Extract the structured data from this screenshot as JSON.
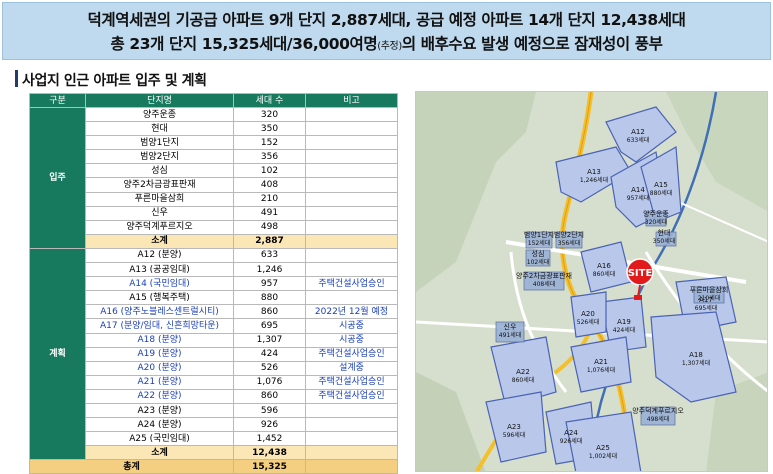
{
  "banner": {
    "line1": "덕계역세권의 기공급 아파트 9개 단지 2,887세대, 공급 예정 아파트 14개 단지 12,438세대",
    "line2a": "총 23개 단지 15,325세대/36,000여명",
    "line2b": "(추정)",
    "line2c": "의 배후수요 발생 예정으로 잠재성이 풍부"
  },
  "section_title": "사업지 인근 아파트 입주 및 계획",
  "table": {
    "headers": [
      "구분",
      "단지명",
      "세대 수",
      "비고"
    ],
    "groups": [
      {
        "label": "입주",
        "rows": [
          {
            "name": "양주운종",
            "units": "320",
            "note": "",
            "blue": false
          },
          {
            "name": "현대",
            "units": "350",
            "note": "",
            "blue": false
          },
          {
            "name": "범양1단지",
            "units": "152",
            "note": "",
            "blue": false
          },
          {
            "name": "범양2단지",
            "units": "356",
            "note": "",
            "blue": false
          },
          {
            "name": "성심",
            "units": "102",
            "note": "",
            "blue": false
          },
          {
            "name": "양주2차금광표판재",
            "units": "408",
            "note": "",
            "blue": false
          },
          {
            "name": "푸른마을삼희",
            "units": "210",
            "note": "",
            "blue": false
          },
          {
            "name": "신우",
            "units": "491",
            "note": "",
            "blue": false
          },
          {
            "name": "양주덕계푸르지오",
            "units": "498",
            "note": "",
            "blue": false
          }
        ],
        "subtotal_label": "소계",
        "subtotal": "2,887"
      },
      {
        "label": "계획",
        "rows": [
          {
            "name": "A12 (분양)",
            "units": "633",
            "note": "",
            "blue": false
          },
          {
            "name": "A13 (공공임대)",
            "units": "1,246",
            "note": "",
            "blue": false
          },
          {
            "name": "A14 (국민임대)",
            "units": "957",
            "note": "주택건설사업승인",
            "blue": true
          },
          {
            "name": "A15 (행복주택)",
            "units": "880",
            "note": "",
            "blue": false
          },
          {
            "name": "A16 (양주노블레스센트럴시티)",
            "units": "860",
            "note": "2022년 12월 예정",
            "blue": true
          },
          {
            "name": "A17 (분양/임대, 신흔희망타운)",
            "units": "695",
            "note": "시공중",
            "blue": true
          },
          {
            "name": "A18 (분양)",
            "units": "1,307",
            "note": "시공중",
            "blue": true
          },
          {
            "name": "A19 (분양)",
            "units": "424",
            "note": "주택건설사업승인",
            "blue": true
          },
          {
            "name": "A20 (분양)",
            "units": "526",
            "note": "설계중",
            "blue": true
          },
          {
            "name": "A21 (분양)",
            "units": "1,076",
            "note": "주택건설사업승인",
            "blue": true
          },
          {
            "name": "A22 (분양)",
            "units": "860",
            "note": "주택건설사업승인",
            "blue": true
          },
          {
            "name": "A23 (분양)",
            "units": "596",
            "note": "",
            "blue": false
          },
          {
            "name": "A24 (분양)",
            "units": "926",
            "note": "",
            "blue": false
          },
          {
            "name": "A25 (국민임대)",
            "units": "1,452",
            "note": "",
            "blue": false
          }
        ],
        "subtotal_label": "소계",
        "subtotal": "12,438"
      }
    ],
    "total_label": "총계",
    "total": "15,325"
  },
  "map": {
    "site_label": "SITE",
    "areas": [
      {
        "name": "A12",
        "units": "633세대"
      },
      {
        "name": "A13",
        "units": "1,246세대"
      },
      {
        "name": "A14",
        "units": "957세대"
      },
      {
        "name": "A15",
        "units": "880세대"
      },
      {
        "name": "A16",
        "units": "860세대"
      },
      {
        "name": "A17",
        "units": "695세대"
      },
      {
        "name": "A18",
        "units": "1,307세대"
      },
      {
        "name": "A19",
        "units": "424세대"
      },
      {
        "name": "A20",
        "units": "526세대"
      },
      {
        "name": "A21",
        "units": "1,076세대"
      },
      {
        "name": "A22",
        "units": "860세대"
      },
      {
        "name": "A23",
        "units": "596세대"
      },
      {
        "name": "A24",
        "units": "926세대"
      },
      {
        "name": "A25",
        "units": "1,002세대"
      }
    ],
    "existing": [
      {
        "name": "범양1단지",
        "units": "152세대"
      },
      {
        "name": "범양2단지",
        "units": "356세대"
      },
      {
        "name": "성심",
        "units": "102세대"
      },
      {
        "name": "양주2차금광표판재",
        "units": "408세대"
      },
      {
        "name": "양주운종",
        "units": "320세대"
      },
      {
        "name": "현대",
        "units": "350세대"
      },
      {
        "name": "푸른마을삼희",
        "units": "210세대"
      },
      {
        "name": "신우",
        "units": "491세대"
      },
      {
        "name": "양주덕계푸르지오",
        "units": "498세대"
      }
    ]
  }
}
